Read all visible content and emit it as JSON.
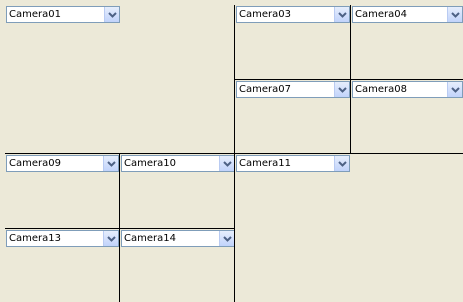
{
  "cameras": {
    "c01": "Camera01",
    "c03": "Camera03",
    "c04": "Camera04",
    "c07": "Camera07",
    "c08": "Camera08",
    "c09": "Camera09",
    "c10": "Camera10",
    "c11": "Camera11",
    "c13": "Camera13",
    "c14": "Camera14"
  },
  "icons": {
    "dropdown": "chevron-down-icon"
  },
  "colors": {
    "background": "#ece9d8",
    "divider": "#000000",
    "combo_border": "#7f9db9",
    "arrow": "#4d6185"
  }
}
